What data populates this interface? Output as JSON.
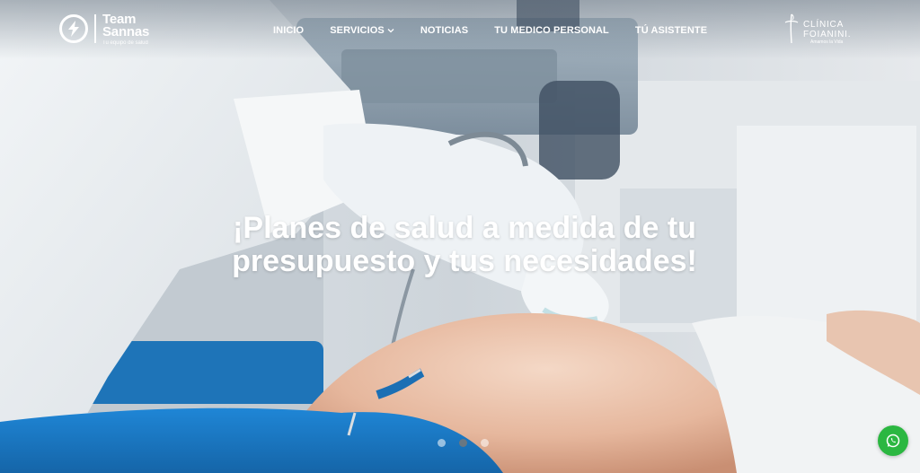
{
  "brand": {
    "name_line1": "Team",
    "name_line2": "Sannas",
    "tagline": "Tu equipo de salud"
  },
  "nav": {
    "items": [
      {
        "label": "INICIO"
      },
      {
        "label": "SERVICIOS",
        "has_dropdown": true
      },
      {
        "label": "NOTICIAS"
      },
      {
        "label": "TU MEDICO PERSONAL"
      },
      {
        "label": "TÚ ASISTENTE"
      }
    ]
  },
  "partner": {
    "line1": "CLÍNICA",
    "line2": "FOIANINI.",
    "slogan": "Amamos la Vida"
  },
  "hero": {
    "headline_line1": "¡Planes de salud a medida de tu",
    "headline_line2": "presupuesto y tus necesidades!"
  },
  "slider": {
    "total": 3,
    "active_index": 1
  },
  "icons": {
    "brand_mark": "lightning-bolt-circle-icon",
    "dropdown": "chevron-down-icon",
    "partner_mark": "cross-icon",
    "chat": "whatsapp-icon"
  },
  "colors": {
    "whatsapp": "#2bb741",
    "nav_text": "#ffffff",
    "shorts": "#1a78c2"
  }
}
